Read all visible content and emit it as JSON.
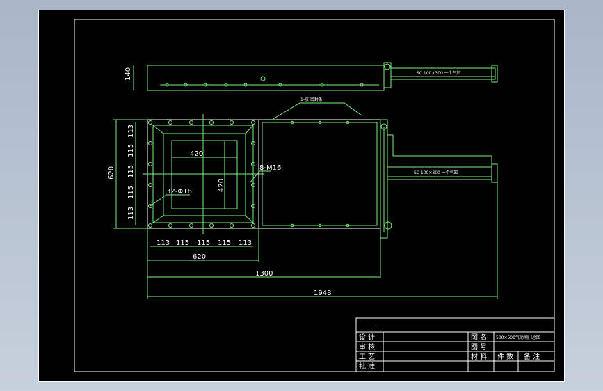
{
  "drawing": {
    "colors": {
      "background": "#000000",
      "geometry": "#7cf07c",
      "text": "#ffffff",
      "window": "#b8c4d4"
    },
    "top_view": {
      "height_dim": "140",
      "cylinder_note": "SC 100×300 一个气缸"
    },
    "front_view": {
      "seal_note": "1-胶 密封条",
      "dims": {
        "overall_height": "620",
        "inner_w": "420",
        "inner_h": "420",
        "bolt_holes": "8-M16",
        "flange_holes": "32-Φ18",
        "left_pitches": [
          "113",
          "115",
          "115",
          "115",
          "113"
        ],
        "bottom_pitches": [
          "113",
          "115",
          "115",
          "115",
          "113"
        ],
        "flange_width": "620",
        "body_length": "1300",
        "overall_length": "1948"
      },
      "cylinder_note": "SC 100×300 一个气缸"
    },
    "title_block": {
      "header_mark": "· ·",
      "rows": [
        {
          "label": "设 计"
        },
        {
          "label": "审 核"
        },
        {
          "label": "工 艺"
        },
        {
          "label": "批 准"
        }
      ],
      "drawing_name_label": "图 名",
      "drawing_name": "500×500气动闸门总图",
      "drawing_no_label": "图 号",
      "material_label": "材 料",
      "qty_label": "件 数",
      "remark_label": "备 注"
    }
  }
}
